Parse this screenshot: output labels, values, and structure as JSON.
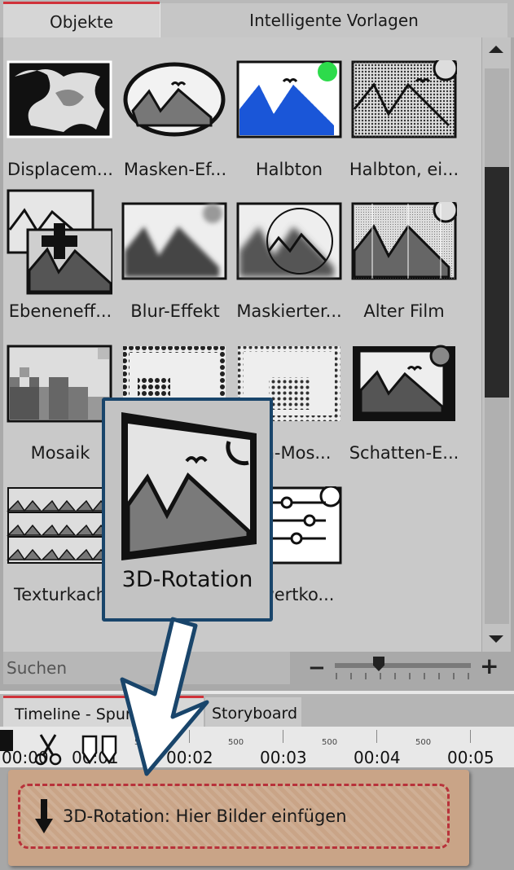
{
  "tabs": {
    "objects": "Objekte",
    "templates": "Intelligente Vorlagen"
  },
  "effects": [
    {
      "label": "Displacem...",
      "icon": "displacement-effect-icon"
    },
    {
      "label": "Masken-Ef...",
      "icon": "mask-effect-icon"
    },
    {
      "label": "Halbton",
      "icon": "halftone-icon"
    },
    {
      "label": "Halbton, ei...",
      "icon": "halftone-single-icon"
    },
    {
      "label": "Ebeneneff...",
      "icon": "layer-effect-icon"
    },
    {
      "label": "Blur-Effekt",
      "icon": "blur-effect-icon"
    },
    {
      "label": "Maskierter...",
      "icon": "masked-icon"
    },
    {
      "label": "Alter Film",
      "icon": "old-film-icon"
    },
    {
      "label": "Mosaik",
      "icon": "mosaic-icon"
    },
    {
      "label": "",
      "icon": "dot-mosaic-icon"
    },
    {
      "label": "...n-Mos...",
      "icon": "dot-mosaic-color-icon"
    },
    {
      "label": "Schatten-E...",
      "icon": "shadow-effect-icon"
    },
    {
      "label": "Texturkach",
      "icon": "texture-tile-icon"
    },
    {
      "label": "",
      "icon": "hidden-icon"
    },
    {
      "label": "...wertko...",
      "icon": "value-correction-icon"
    }
  ],
  "popup": {
    "label": "3D-Rotation",
    "icon": "3d-rotation-icon"
  },
  "search": {
    "placeholder": "Suchen"
  },
  "zoom": {
    "minus": "−",
    "plus": "+",
    "level": 0.33
  },
  "timeline": {
    "tab_timeline": "Timeline - Spur",
    "tab_storyboard": "Storyboard",
    "times": [
      "00:00",
      "00:01",
      "00:02",
      "00:03",
      "00:04",
      "00:05"
    ],
    "half_mark": "500",
    "drop_text": "3D-Rotation: Hier Bilder einfügen"
  },
  "colors": {
    "accent_red": "#d0323a",
    "popup_border": "#19456b",
    "clip": "#c9a487"
  }
}
